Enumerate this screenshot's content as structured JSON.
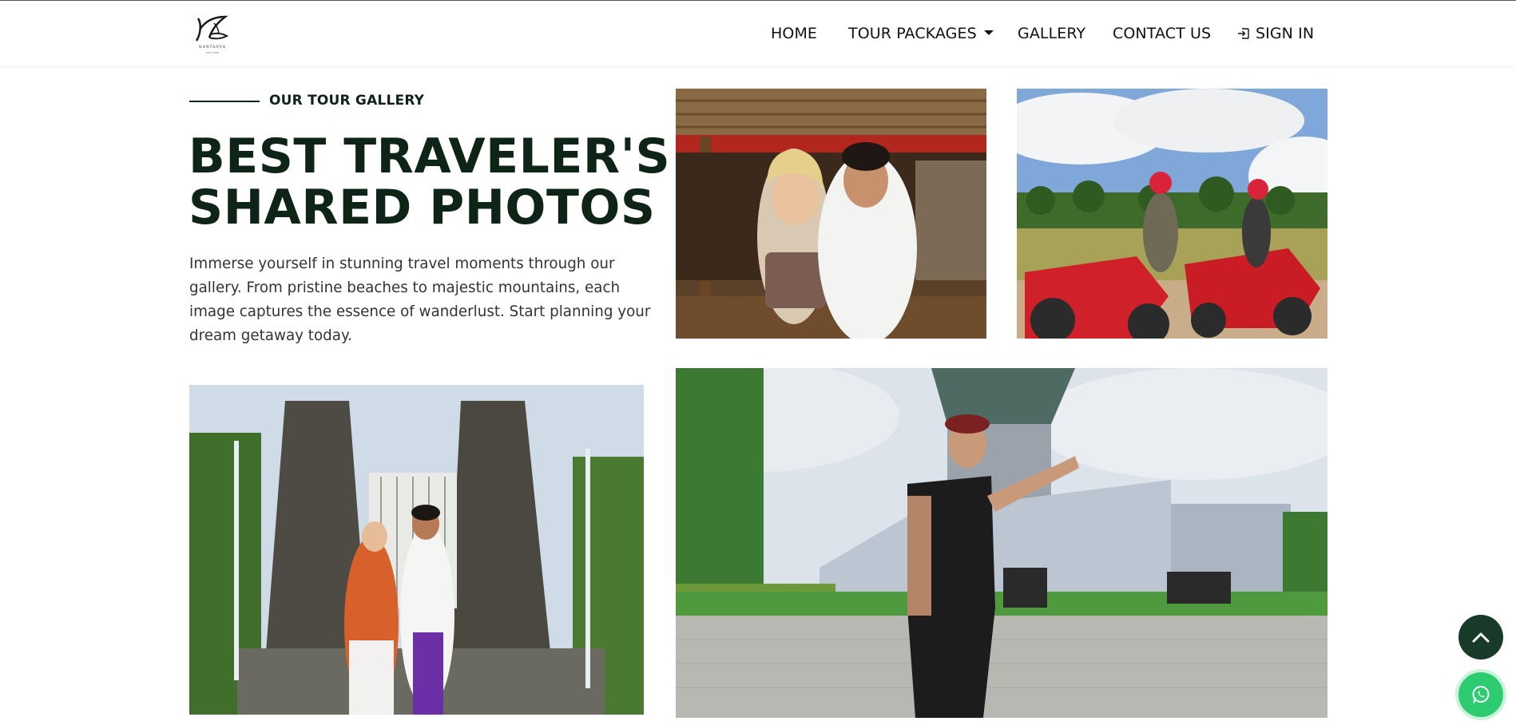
{
  "brand": {
    "name": "KANTANYA",
    "tagline": "BALI TOUR",
    "logo_icon": "leaf-logo-icon"
  },
  "nav": {
    "home": "HOME",
    "tour_packages": "TOUR PACKAGES",
    "gallery": "GALLERY",
    "contact": "CONTACT US",
    "sign_in": "SIGN IN"
  },
  "hero": {
    "eyebrow": "OUR TOUR GALLERY",
    "title_line1": "BEST TRAVELER'S",
    "title_line2": "SHARED PHOTOS",
    "description": "Immerse yourself in stunning travel moments through our gallery. From pristine beaches to majestic mountains, each image captures the essence of wanderlust. Start planning your dream getaway today."
  },
  "gallery": {
    "photos": [
      {
        "subject": "couple-in-pavilion-photo"
      },
      {
        "subject": "atv-riders-photo"
      },
      {
        "subject": "couple-at-temple-gate-photo"
      },
      {
        "subject": "man-at-statue-park-photo"
      }
    ]
  },
  "fab": {
    "scroll_top_icon": "chevron-up-icon",
    "whatsapp_icon": "whatsapp-icon"
  },
  "colors": {
    "primary_dark": "#0d2417",
    "scroll_button": "#183a28",
    "whatsapp": "#2ecc71"
  }
}
